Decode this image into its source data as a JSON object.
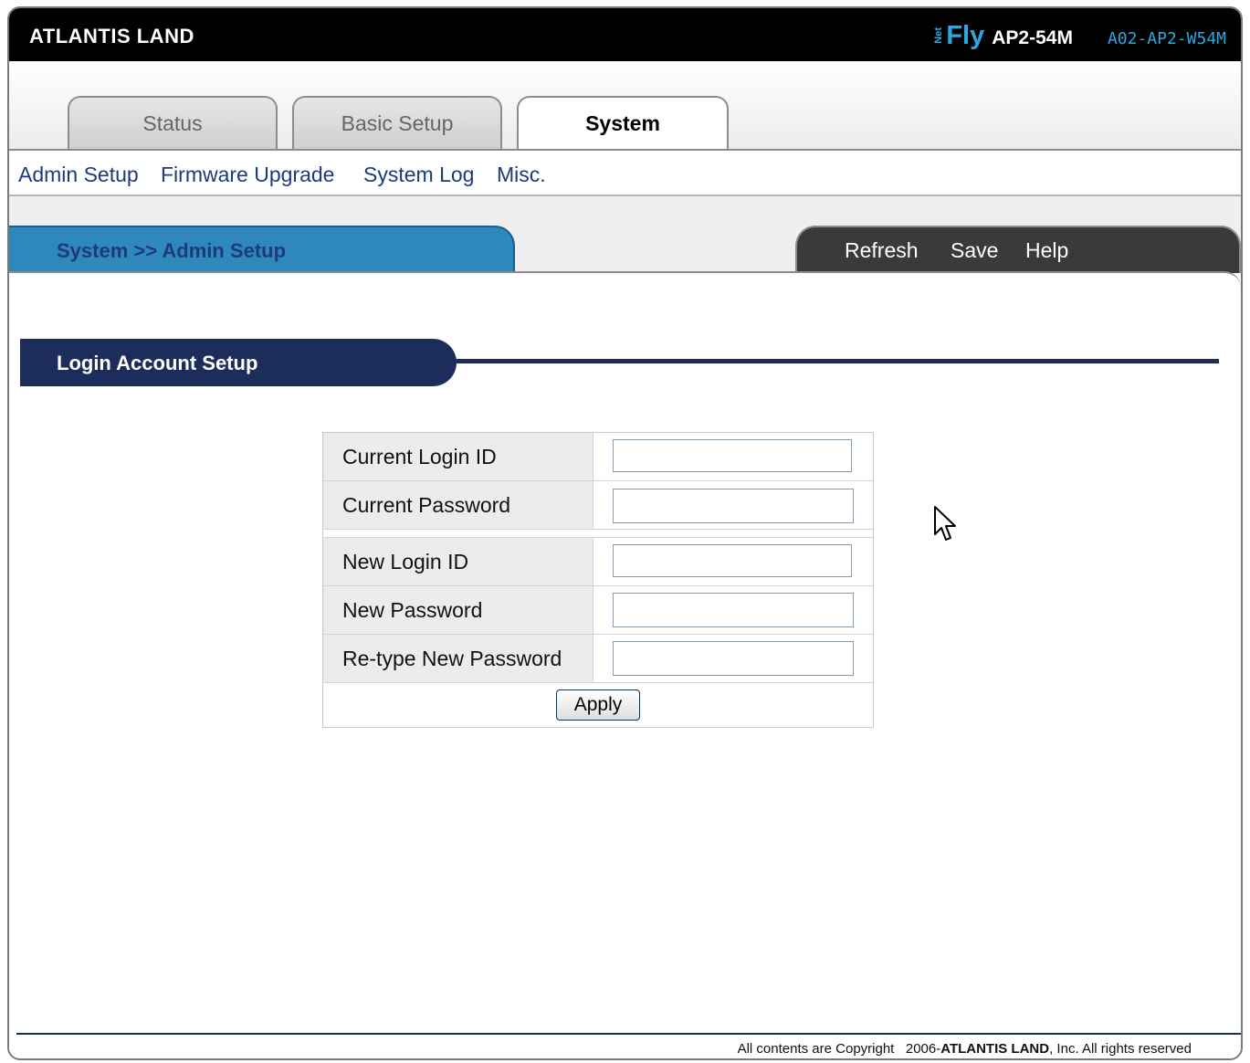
{
  "header": {
    "brand": "ATLANTIS LAND",
    "net_tag": "Net",
    "fly": "Fly",
    "model": "AP2-54M",
    "code": "A02-AP2-W54M"
  },
  "tabs": [
    {
      "label": "Status",
      "active": false
    },
    {
      "label": "Basic Setup",
      "active": false
    },
    {
      "label": "System",
      "active": true
    }
  ],
  "subnav": [
    "Admin Setup",
    "Firmware Upgrade",
    "System Log",
    "Misc."
  ],
  "breadcrumb": "System >> Admin Setup",
  "actions": [
    "Refresh",
    "Save",
    "Help"
  ],
  "section": {
    "title": "Login Account Setup"
  },
  "form": {
    "current": [
      {
        "label": "Current Login ID",
        "value": ""
      },
      {
        "label": "Current Password",
        "value": ""
      }
    ],
    "new": [
      {
        "label": "New Login ID",
        "value": ""
      },
      {
        "label": "New Password",
        "value": ""
      },
      {
        "label": "Re-type New Password",
        "value": ""
      }
    ],
    "apply_label": "Apply"
  },
  "footer": {
    "prefix": "All contents are Copyright   2006-",
    "company": "ATLANTIS LAND",
    "suffix": ", Inc. All rights reserved"
  },
  "colors": {
    "accent_blue": "#29a9e0",
    "breadcrumb_bg": "#2f88bd",
    "section_bg": "#1c2d5c"
  }
}
